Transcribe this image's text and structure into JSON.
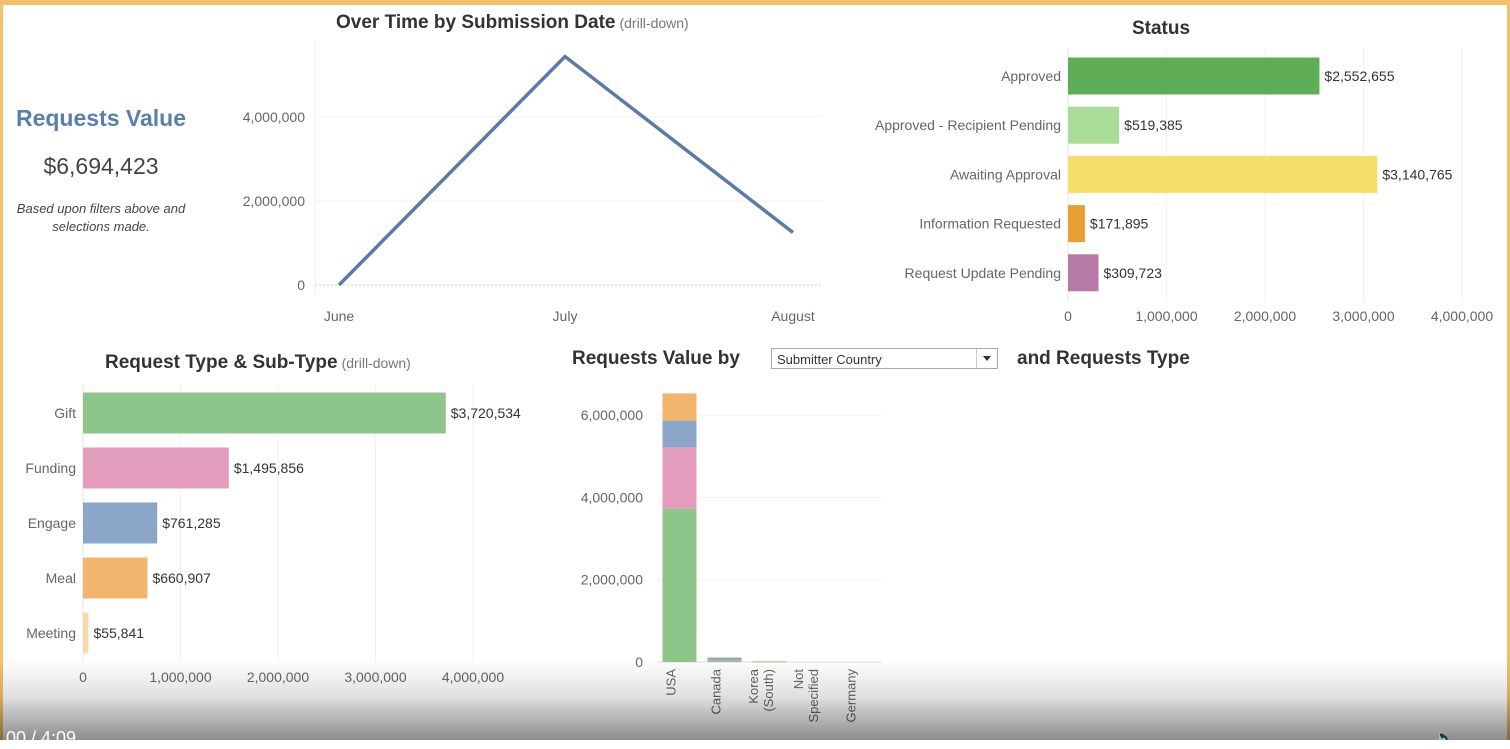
{
  "kpi": {
    "title": "Requests Value",
    "value": "$6,694,423",
    "note": "Based upon filters above and selections made."
  },
  "dropdown": {
    "selected": "Submitter Country"
  },
  "player": {
    "time": "00 / 4:09",
    "icon": "volume-icon"
  },
  "colors": {
    "accent_frame": "#f3c06b",
    "line": "#5b7aa6",
    "kpi_title": "#5b7fac"
  },
  "chart_data": [
    {
      "id": "over_time",
      "type": "line",
      "title": "Over Time by Submission Date",
      "subtitle": "(drill-down)",
      "x": [
        "June",
        "July",
        "August"
      ],
      "y_ticks": [
        "0",
        "2,000,000",
        "4,000,000"
      ],
      "ylim": [
        0,
        6000000
      ],
      "series": [
        {
          "values": [
            0,
            5440000,
            1250000
          ]
        }
      ],
      "grid": true
    },
    {
      "id": "status",
      "type": "bar",
      "orientation": "horizontal",
      "title": "Status",
      "categories": [
        "Approved",
        "Approved - Recipient Pending",
        "Awaiting Approval",
        "Information Requested",
        "Request Update Pending"
      ],
      "values": [
        2552655,
        519385,
        3140765,
        171895,
        309723
      ],
      "labels": [
        "$2,552,655",
        "$519,385",
        "$3,140,765",
        "$171,895",
        "$309,723"
      ],
      "colors": [
        "#5fad56",
        "#a9dd97",
        "#f7dd6a",
        "#e8a034",
        "#b57ba6"
      ],
      "x_ticks": [
        "0",
        "1,000,000",
        "2,000,000",
        "3,000,000",
        "4,000,000"
      ],
      "xlim": [
        0,
        4000000
      ]
    },
    {
      "id": "request_type",
      "type": "bar",
      "orientation": "horizontal",
      "title": "Request Type & Sub-Type",
      "subtitle": "(drill-down)",
      "categories": [
        "Gift",
        "Funding",
        "Engage",
        "Meal",
        "Meeting"
      ],
      "values": [
        3720534,
        1495856,
        761285,
        660907,
        55841
      ],
      "labels": [
        "$3,720,534",
        "$1,495,856",
        "$761,285",
        "$660,907",
        "$55,841"
      ],
      "colors": [
        "#8ec58a",
        "#e49cbd",
        "#8ba6c9",
        "#f2b56e",
        "#f8d9ab"
      ],
      "x_ticks": [
        "0",
        "1,000,000",
        "2,000,000",
        "3,000,000",
        "4,000,000"
      ],
      "xlim": [
        0,
        4000000
      ]
    },
    {
      "id": "by_country",
      "type": "bar",
      "stacked": true,
      "title_prefix": "Requests Value by",
      "title_suffix": "and Requests Type",
      "categories": [
        "USA",
        "Canada",
        "Korea (South)",
        "Not Specified",
        "Germany"
      ],
      "y_ticks": [
        "0",
        "2,000,000",
        "4,000,000",
        "6,000,000"
      ],
      "ylim": [
        0,
        7000000
      ],
      "series": [
        {
          "color": "#8ec58a",
          "values": [
            3720534,
            30000,
            8000,
            0,
            0
          ]
        },
        {
          "color": "#e49cbd",
          "values": [
            1495856,
            10000,
            3000,
            0,
            0
          ]
        },
        {
          "color": "#8ba6c9",
          "values": [
            650000,
            60000,
            4000,
            0,
            0
          ]
        },
        {
          "color": "#f2b56e",
          "values": [
            660907,
            15000,
            2000,
            0,
            0
          ]
        }
      ]
    }
  ]
}
